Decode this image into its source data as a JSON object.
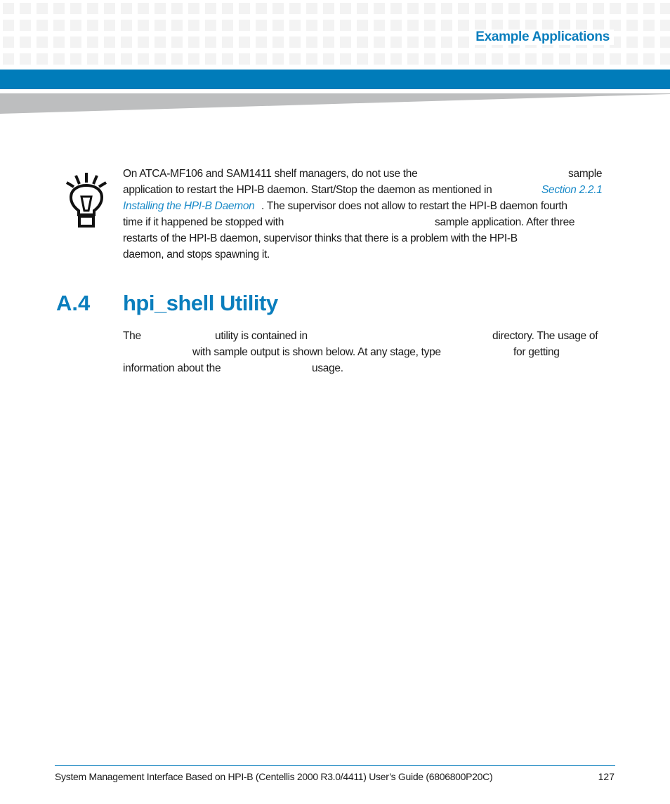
{
  "header": {
    "section_title": "Example Applications",
    "brand_color": "#007cba"
  },
  "tip": {
    "icon": "lightbulb-icon",
    "lines": [
      {
        "parts": [
          "On ATCA-MF106 and SAM1411 shelf managers, do not use the",
          "sample"
        ]
      },
      {
        "parts": [
          "application to restart the HPI-B daemon. Start/Stop the daemon as mentioned in ",
          "Section 2.2.1"
        ]
      },
      {
        "parts": [
          "Installing the HPI-B Daemon",
          ". The supervisor does not allow to restart the HPI-B daemon fourth"
        ]
      },
      {
        "parts": [
          "time if it happened be stopped with",
          "sample application. After three"
        ]
      },
      {
        "parts": [
          "restarts of the HPI-B daemon, supervisor thinks that there is a problem with the HPI-B"
        ]
      },
      {
        "parts": [
          "daemon, and stops spawning it."
        ]
      }
    ]
  },
  "section": {
    "number": "A.4",
    "title": "hpi_shell Utility"
  },
  "body": {
    "lines": [
      {
        "parts": [
          "The",
          "utility is contained in",
          "directory. The usage of"
        ]
      },
      {
        "parts": [
          "with sample output is shown below. At any stage, type",
          "for getting"
        ]
      },
      {
        "parts": [
          "information about the",
          "usage."
        ]
      }
    ]
  },
  "footer": {
    "text": "System Management Interface Based on HPI-B (Centellis 2000 R3.0/4411) User’s Guide (6806800P20C)",
    "page_number": "127"
  }
}
